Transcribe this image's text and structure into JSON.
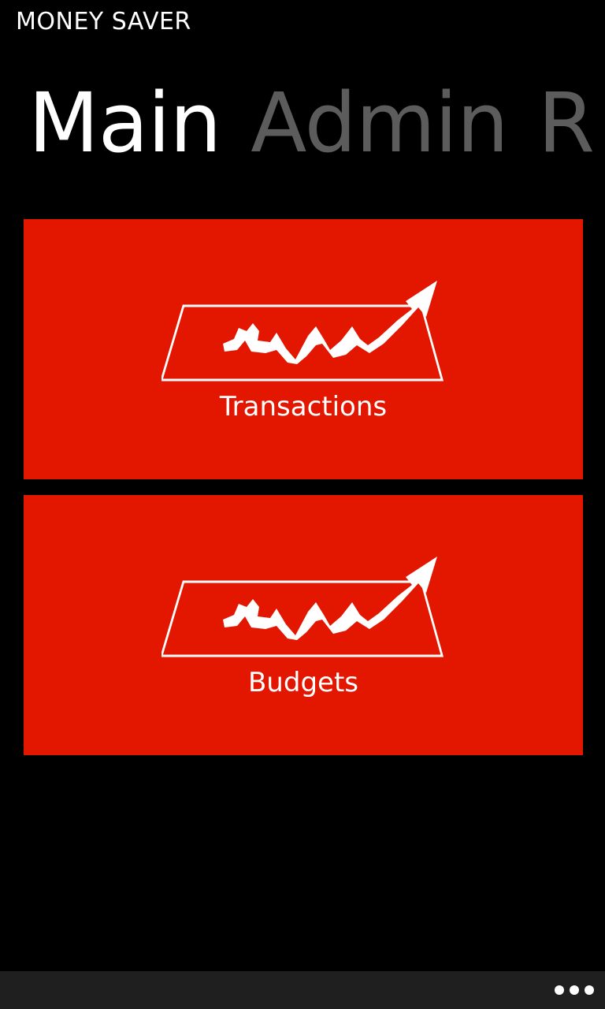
{
  "app": {
    "title": "MONEY SAVER"
  },
  "pivot": {
    "tabs": [
      {
        "label": "Main",
        "active": true
      },
      {
        "label": "Admin",
        "active": false
      },
      {
        "label": "R",
        "active": false
      }
    ]
  },
  "tiles": [
    {
      "label": "Transactions",
      "icon": "trending-chart-icon",
      "color": "#e31600"
    },
    {
      "label": "Budgets",
      "icon": "trending-chart-icon",
      "color": "#e31600"
    }
  ],
  "app_bar": {
    "more_icon": "ellipsis-icon"
  },
  "colors": {
    "accent": "#e31600",
    "background": "#000000",
    "inactive_tab": "#5c5c5c",
    "app_bar": "#1f1f1f"
  }
}
